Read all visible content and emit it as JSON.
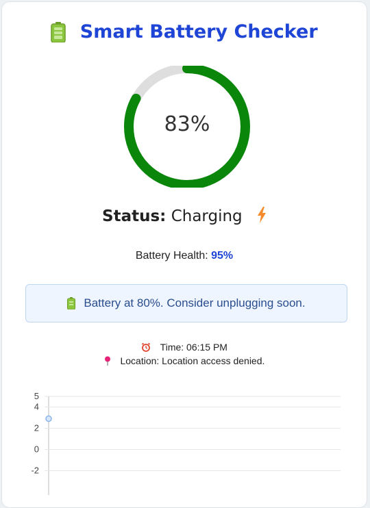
{
  "app": {
    "title": "Smart Battery Checker"
  },
  "battery": {
    "level_text": "83%",
    "level_fraction": 0.83,
    "gauge_color": "#0a870a",
    "track_color": "#dedede"
  },
  "status": {
    "label": "Status:",
    "value": "Charging",
    "icon": "lightning-bolt-icon",
    "icon_color": "#f6892a"
  },
  "health": {
    "label": "Battery Health:",
    "value": "95%"
  },
  "alert": {
    "icon": "battery-icon",
    "message": "Battery at 80%. Consider unplugging soon."
  },
  "info": {
    "time_icon": "alarm-clock-icon",
    "time": "Time: 06:15 PM",
    "location_icon": "pushpin-icon",
    "location": "Location: Location access denied."
  },
  "colors": {
    "title": "#1f45d6",
    "alert_bg": "#eef5fe",
    "alert_border": "#bcd6f3",
    "alert_text": "#2a4d8f"
  },
  "chart_data": {
    "type": "line",
    "y_ticks": [
      "5",
      "4",
      "2",
      "0",
      "-2"
    ],
    "ylim": [
      -3,
      5
    ],
    "points": [
      {
        "x": 0,
        "y": 2.9
      }
    ],
    "point_color": "#8ab4e8",
    "grid": true
  }
}
